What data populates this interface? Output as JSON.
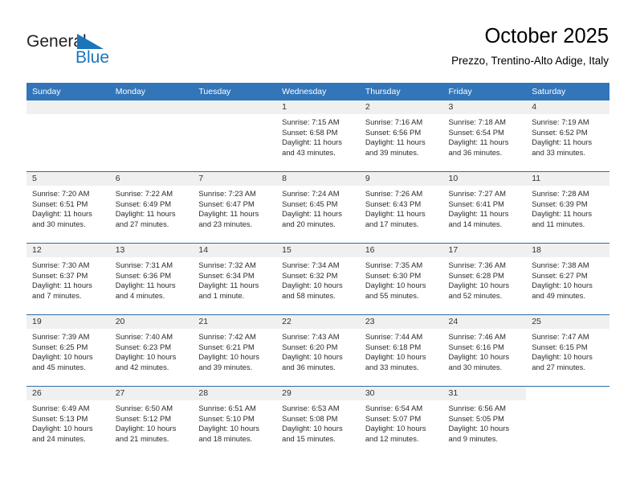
{
  "brand": {
    "name_line1": "General",
    "name_line2": "Blue",
    "logo_icon": "blue-triangle-flag-icon",
    "color_blue": "#1b75bb",
    "color_dark": "#231f20"
  },
  "header": {
    "title": "October 2025",
    "subtitle": "Prezzo, Trentino-Alto Adige, Italy"
  },
  "theme": {
    "header_row_bg": "#3275b9",
    "header_row_text": "#ffffff",
    "daynum_band_bg": "#f0f0f0",
    "cell_border": "#2d6da3",
    "page_bg": "#ffffff"
  },
  "weekdays": [
    "Sunday",
    "Monday",
    "Tuesday",
    "Wednesday",
    "Thursday",
    "Friday",
    "Saturday"
  ],
  "labels": {
    "sunrise_prefix": "Sunrise:",
    "sunset_prefix": "Sunset:",
    "daylight_prefix": "Daylight:"
  },
  "weeks": [
    [
      {
        "empty": true
      },
      {
        "empty": true
      },
      {
        "empty": true
      },
      {
        "day": "1",
        "sunrise": "Sunrise: 7:15 AM",
        "sunset": "Sunset: 6:58 PM",
        "daylight_1": "Daylight: 11 hours",
        "daylight_2": "and 43 minutes."
      },
      {
        "day": "2",
        "sunrise": "Sunrise: 7:16 AM",
        "sunset": "Sunset: 6:56 PM",
        "daylight_1": "Daylight: 11 hours",
        "daylight_2": "and 39 minutes."
      },
      {
        "day": "3",
        "sunrise": "Sunrise: 7:18 AM",
        "sunset": "Sunset: 6:54 PM",
        "daylight_1": "Daylight: 11 hours",
        "daylight_2": "and 36 minutes."
      },
      {
        "day": "4",
        "sunrise": "Sunrise: 7:19 AM",
        "sunset": "Sunset: 6:52 PM",
        "daylight_1": "Daylight: 11 hours",
        "daylight_2": "and 33 minutes."
      }
    ],
    [
      {
        "day": "5",
        "sunrise": "Sunrise: 7:20 AM",
        "sunset": "Sunset: 6:51 PM",
        "daylight_1": "Daylight: 11 hours",
        "daylight_2": "and 30 minutes."
      },
      {
        "day": "6",
        "sunrise": "Sunrise: 7:22 AM",
        "sunset": "Sunset: 6:49 PM",
        "daylight_1": "Daylight: 11 hours",
        "daylight_2": "and 27 minutes."
      },
      {
        "day": "7",
        "sunrise": "Sunrise: 7:23 AM",
        "sunset": "Sunset: 6:47 PM",
        "daylight_1": "Daylight: 11 hours",
        "daylight_2": "and 23 minutes."
      },
      {
        "day": "8",
        "sunrise": "Sunrise: 7:24 AM",
        "sunset": "Sunset: 6:45 PM",
        "daylight_1": "Daylight: 11 hours",
        "daylight_2": "and 20 minutes."
      },
      {
        "day": "9",
        "sunrise": "Sunrise: 7:26 AM",
        "sunset": "Sunset: 6:43 PM",
        "daylight_1": "Daylight: 11 hours",
        "daylight_2": "and 17 minutes."
      },
      {
        "day": "10",
        "sunrise": "Sunrise: 7:27 AM",
        "sunset": "Sunset: 6:41 PM",
        "daylight_1": "Daylight: 11 hours",
        "daylight_2": "and 14 minutes."
      },
      {
        "day": "11",
        "sunrise": "Sunrise: 7:28 AM",
        "sunset": "Sunset: 6:39 PM",
        "daylight_1": "Daylight: 11 hours",
        "daylight_2": "and 11 minutes."
      }
    ],
    [
      {
        "day": "12",
        "sunrise": "Sunrise: 7:30 AM",
        "sunset": "Sunset: 6:37 PM",
        "daylight_1": "Daylight: 11 hours",
        "daylight_2": "and 7 minutes."
      },
      {
        "day": "13",
        "sunrise": "Sunrise: 7:31 AM",
        "sunset": "Sunset: 6:36 PM",
        "daylight_1": "Daylight: 11 hours",
        "daylight_2": "and 4 minutes."
      },
      {
        "day": "14",
        "sunrise": "Sunrise: 7:32 AM",
        "sunset": "Sunset: 6:34 PM",
        "daylight_1": "Daylight: 11 hours",
        "daylight_2": "and 1 minute."
      },
      {
        "day": "15",
        "sunrise": "Sunrise: 7:34 AM",
        "sunset": "Sunset: 6:32 PM",
        "daylight_1": "Daylight: 10 hours",
        "daylight_2": "and 58 minutes."
      },
      {
        "day": "16",
        "sunrise": "Sunrise: 7:35 AM",
        "sunset": "Sunset: 6:30 PM",
        "daylight_1": "Daylight: 10 hours",
        "daylight_2": "and 55 minutes."
      },
      {
        "day": "17",
        "sunrise": "Sunrise: 7:36 AM",
        "sunset": "Sunset: 6:28 PM",
        "daylight_1": "Daylight: 10 hours",
        "daylight_2": "and 52 minutes."
      },
      {
        "day": "18",
        "sunrise": "Sunrise: 7:38 AM",
        "sunset": "Sunset: 6:27 PM",
        "daylight_1": "Daylight: 10 hours",
        "daylight_2": "and 49 minutes."
      }
    ],
    [
      {
        "day": "19",
        "sunrise": "Sunrise: 7:39 AM",
        "sunset": "Sunset: 6:25 PM",
        "daylight_1": "Daylight: 10 hours",
        "daylight_2": "and 45 minutes."
      },
      {
        "day": "20",
        "sunrise": "Sunrise: 7:40 AM",
        "sunset": "Sunset: 6:23 PM",
        "daylight_1": "Daylight: 10 hours",
        "daylight_2": "and 42 minutes."
      },
      {
        "day": "21",
        "sunrise": "Sunrise: 7:42 AM",
        "sunset": "Sunset: 6:21 PM",
        "daylight_1": "Daylight: 10 hours",
        "daylight_2": "and 39 minutes."
      },
      {
        "day": "22",
        "sunrise": "Sunrise: 7:43 AM",
        "sunset": "Sunset: 6:20 PM",
        "daylight_1": "Daylight: 10 hours",
        "daylight_2": "and 36 minutes."
      },
      {
        "day": "23",
        "sunrise": "Sunrise: 7:44 AM",
        "sunset": "Sunset: 6:18 PM",
        "daylight_1": "Daylight: 10 hours",
        "daylight_2": "and 33 minutes."
      },
      {
        "day": "24",
        "sunrise": "Sunrise: 7:46 AM",
        "sunset": "Sunset: 6:16 PM",
        "daylight_1": "Daylight: 10 hours",
        "daylight_2": "and 30 minutes."
      },
      {
        "day": "25",
        "sunrise": "Sunrise: 7:47 AM",
        "sunset": "Sunset: 6:15 PM",
        "daylight_1": "Daylight: 10 hours",
        "daylight_2": "and 27 minutes."
      }
    ],
    [
      {
        "day": "26",
        "sunrise": "Sunrise: 6:49 AM",
        "sunset": "Sunset: 5:13 PM",
        "daylight_1": "Daylight: 10 hours",
        "daylight_2": "and 24 minutes."
      },
      {
        "day": "27",
        "sunrise": "Sunrise: 6:50 AM",
        "sunset": "Sunset: 5:12 PM",
        "daylight_1": "Daylight: 10 hours",
        "daylight_2": "and 21 minutes."
      },
      {
        "day": "28",
        "sunrise": "Sunrise: 6:51 AM",
        "sunset": "Sunset: 5:10 PM",
        "daylight_1": "Daylight: 10 hours",
        "daylight_2": "and 18 minutes."
      },
      {
        "day": "29",
        "sunrise": "Sunrise: 6:53 AM",
        "sunset": "Sunset: 5:08 PM",
        "daylight_1": "Daylight: 10 hours",
        "daylight_2": "and 15 minutes."
      },
      {
        "day": "30",
        "sunrise": "Sunrise: 6:54 AM",
        "sunset": "Sunset: 5:07 PM",
        "daylight_1": "Daylight: 10 hours",
        "daylight_2": "and 12 minutes."
      },
      {
        "day": "31",
        "sunrise": "Sunrise: 6:56 AM",
        "sunset": "Sunset: 5:05 PM",
        "daylight_1": "Daylight: 10 hours",
        "daylight_2": "and 9 minutes."
      },
      {
        "empty": true
      }
    ]
  ]
}
